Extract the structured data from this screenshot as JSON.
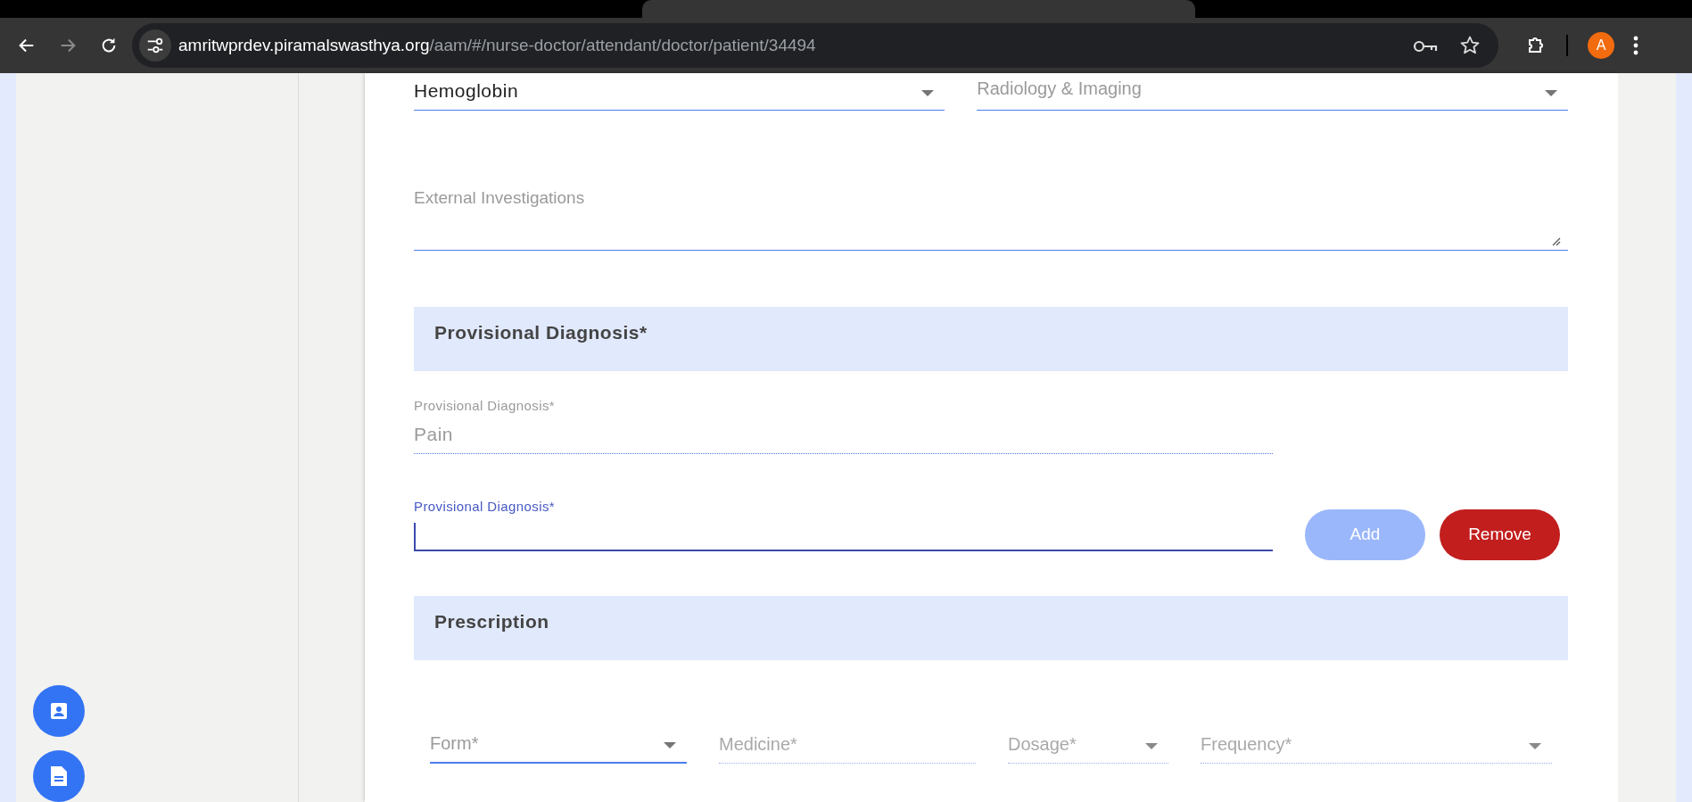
{
  "browser": {
    "url_host": "amritwprdev.piramalswasthya.org",
    "url_path": "/aam/#/nurse-doctor/attendant/doctor/patient/34494",
    "profile_initial": "A",
    "forward_disabled": true
  },
  "investigations": {
    "selects": [
      {
        "value": "Hemoglobin"
      },
      {
        "placeholder": "Radiology & Imaging"
      }
    ],
    "external": {
      "placeholder": "External Investigations"
    }
  },
  "provisional_diagnosis": {
    "title": "Provisional Diagnosis*",
    "entries": [
      {
        "label": "Provisional Diagnosis*",
        "value": "Pain",
        "disabled": true
      }
    ],
    "new_entry": {
      "label": "Provisional Diagnosis*",
      "focused": true
    },
    "buttons": [
      {
        "label": "Add",
        "kind": "add",
        "disabled": true
      },
      {
        "label": "Remove",
        "kind": "remove",
        "disabled": false
      }
    ]
  },
  "prescription": {
    "title": "Prescription",
    "fields": [
      {
        "placeholder": "Form*",
        "kind": "select",
        "disabled": false
      },
      {
        "placeholder": "Medicine*",
        "kind": "input",
        "disabled": true
      },
      {
        "placeholder": "Dosage*",
        "kind": "select",
        "disabled": true
      },
      {
        "placeholder": "Frequency*",
        "kind": "select",
        "disabled": true
      }
    ]
  }
}
